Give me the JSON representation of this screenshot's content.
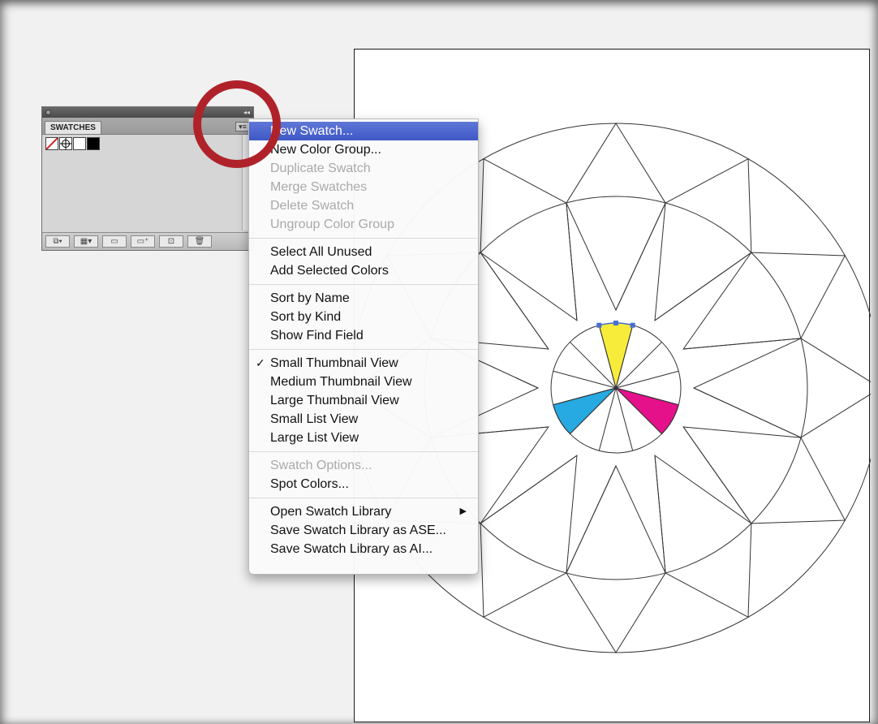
{
  "panel": {
    "tab_label": "SWATCHES",
    "collapse_glyph": "◂◂",
    "menu_button_glyph": "▾≡",
    "swatches": [
      {
        "name": "none-swatch",
        "color": "#ffffff"
      },
      {
        "name": "registration-swatch",
        "color": "#ffffff"
      },
      {
        "name": "white-swatch",
        "color": "#ffffff"
      },
      {
        "name": "black-swatch",
        "color": "#000000"
      }
    ],
    "bottom_buttons": [
      {
        "icon": "swatch-libraries-menu-icon",
        "glyph": "⧉▾"
      },
      {
        "icon": "show-swatch-kinds-icon",
        "glyph": "▦▾"
      },
      {
        "icon": "swatch-options-icon",
        "glyph": "▭"
      },
      {
        "icon": "new-color-group-icon",
        "glyph": "▭⁺"
      },
      {
        "icon": "new-swatch-icon",
        "glyph": "⊡"
      },
      {
        "icon": "delete-swatch-icon",
        "glyph": "🗑"
      }
    ]
  },
  "menu": {
    "items": [
      {
        "label": "New Swatch...",
        "disabled": false,
        "highlighted": true
      },
      {
        "label": "New Color Group...",
        "disabled": false
      },
      {
        "label": "Duplicate Swatch",
        "disabled": true
      },
      {
        "label": "Merge Swatches",
        "disabled": true
      },
      {
        "label": "Delete Swatch",
        "disabled": true
      },
      {
        "label": "Ungroup Color Group",
        "disabled": true
      },
      {
        "separator": true
      },
      {
        "label": "Select All Unused",
        "disabled": false
      },
      {
        "label": "Add Selected Colors",
        "disabled": false
      },
      {
        "separator": true
      },
      {
        "label": "Sort by Name",
        "disabled": false
      },
      {
        "label": "Sort by Kind",
        "disabled": false
      },
      {
        "label": "Show Find Field",
        "disabled": false
      },
      {
        "separator": true
      },
      {
        "label": "Small Thumbnail View",
        "disabled": false,
        "checked": true
      },
      {
        "label": "Medium Thumbnail View",
        "disabled": false
      },
      {
        "label": "Large Thumbnail View",
        "disabled": false
      },
      {
        "label": "Small List View",
        "disabled": false
      },
      {
        "label": "Large List View",
        "disabled": false
      },
      {
        "separator": true
      },
      {
        "label": "Swatch Options...",
        "disabled": true
      },
      {
        "label": "Spot Colors...",
        "disabled": false
      },
      {
        "separator": true
      },
      {
        "label": "Open Swatch Library",
        "disabled": false,
        "submenu": true
      },
      {
        "label": "Save Swatch Library as ASE...",
        "disabled": false
      },
      {
        "label": "Save Swatch Library as AI...",
        "disabled": false
      }
    ],
    "check_glyph": "✓",
    "submenu_glyph": "▶"
  },
  "artwork": {
    "colors": {
      "yellow": "#f7ec3a",
      "cyan": "#27a9e1",
      "magenta": "#e5118b",
      "line": "#333333",
      "selection": "#4a6fd0"
    },
    "annotation_color": "#b0222a"
  }
}
